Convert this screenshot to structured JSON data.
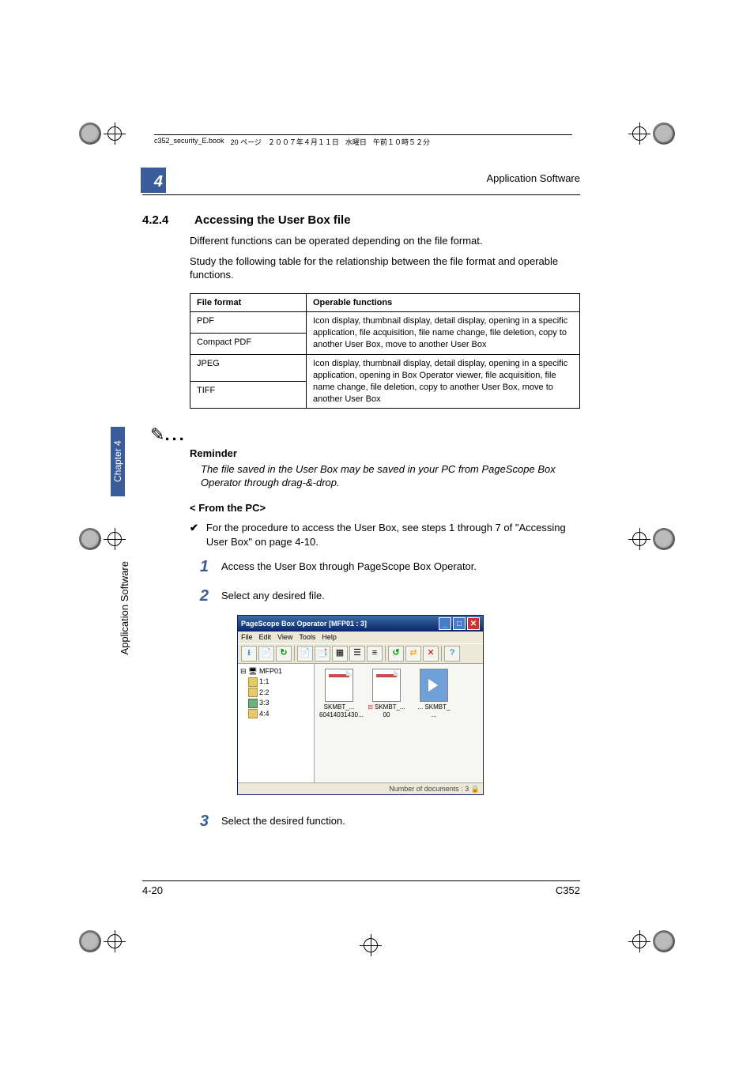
{
  "book_header": {
    "filename": "c352_security_E.book",
    "page_jp": "20 ページ",
    "date_jp": "２００７年４月１１日",
    "day_jp": "水曜日",
    "time_jp": "午前１０時５２分"
  },
  "chapter_tab": "4",
  "running_head": "Application Software",
  "section": {
    "number": "4.2.4",
    "title": "Accessing the User Box file"
  },
  "paragraphs": {
    "p1": "Different functions can be operated depending on the file format.",
    "p2": "Study the following table for the relationship between the file format and operable functions."
  },
  "table": {
    "head_format": "File format",
    "head_ops": "Operable functions",
    "rows": [
      {
        "format": "PDF",
        "ops": "Icon display, thumbnail display, detail display, opening in a specific application, file acquisition, file name change, file deletion, copy to another User Box, move to another User Box",
        "span_first": true
      },
      {
        "format": "Compact PDF"
      },
      {
        "format": "JPEG",
        "ops": "Icon display, thumbnail display, detail display, opening in a specific application, opening in Box Operator viewer, file acquisition, file name change, file deletion, copy to another User Box, move to another User Box",
        "span_first": true
      },
      {
        "format": "TIFF"
      }
    ]
  },
  "reminder": {
    "label": "Reminder",
    "text": "The file saved in the User Box may be saved in your PC from PageScope Box Operator through drag-&-drop."
  },
  "subhead": "< From the PC>",
  "checkline": "For the procedure to access the User Box, see steps 1 through 7 of \"Accessing User Box\" on page 4-10.",
  "steps": {
    "s1": {
      "num": "1",
      "text": "Access the User Box through PageScope Box Operator."
    },
    "s2": {
      "num": "2",
      "text": "Select any desired file."
    },
    "s3": {
      "num": "3",
      "text": "Select the desired function."
    }
  },
  "app_window": {
    "title": "PageScope Box Operator  [MFP01 : 3]",
    "menus": [
      "File",
      "Edit",
      "View",
      "Tools",
      "Help"
    ],
    "toolbar_glyphs": [
      "⭳",
      "📄",
      "↻",
      "",
      "📄",
      "📑",
      "▦",
      "☰",
      "≡",
      "",
      "↺",
      "⇄",
      "✕",
      "",
      "?"
    ],
    "tree": {
      "root": "MFP01",
      "items": [
        {
          "label": "1:1",
          "cls": "y"
        },
        {
          "label": "2:2",
          "cls": "y"
        },
        {
          "label": "3:3",
          "cls": "g"
        },
        {
          "label": "4:4",
          "cls": "y"
        }
      ]
    },
    "docs": [
      {
        "name_top": "SKMBT_...",
        "name_bot": "60414031430..."
      },
      {
        "name_top": "SKMBT_...",
        "name_bot": "00"
      },
      {
        "name_top": "... SKMBT_",
        "name_bot": "..."
      }
    ],
    "status": "Number of documents : 3"
  },
  "side": {
    "band": "Chapter 4",
    "label": "Application Software"
  },
  "footer": {
    "left": "4-20",
    "right": "C352"
  }
}
